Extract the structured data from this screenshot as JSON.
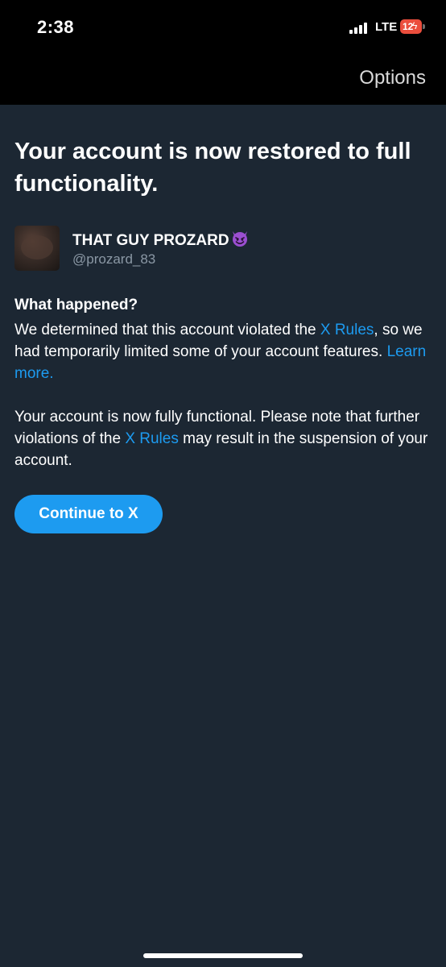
{
  "status_bar": {
    "time": "2:38",
    "network": "LTE",
    "battery": "12"
  },
  "nav": {
    "options_label": "Options"
  },
  "main": {
    "headline": "Your account is now restored to full functionality.",
    "account": {
      "display_name": "THAT GUY PROZARD",
      "handle": "@prozard_83",
      "name_emoji": "smiling-devil-emoji"
    },
    "what_happened_title": "What happened?",
    "paragraph1": {
      "part1": "We determined that this account violated the ",
      "link1": "X Rules",
      "part2": ", so we had temporarily limited some of your account features. ",
      "link2": "Learn more."
    },
    "paragraph2": {
      "part1": "Your account is now fully functional. Please note that further violations of the ",
      "link1": "X Rules",
      "part2": " may result in the suspension of your account."
    },
    "continue_label": "Continue to X"
  },
  "colors": {
    "background": "#1c2733",
    "accent": "#1d9bf0",
    "secondary_text": "#8b98a5",
    "battery_low": "#eb4e3d"
  }
}
